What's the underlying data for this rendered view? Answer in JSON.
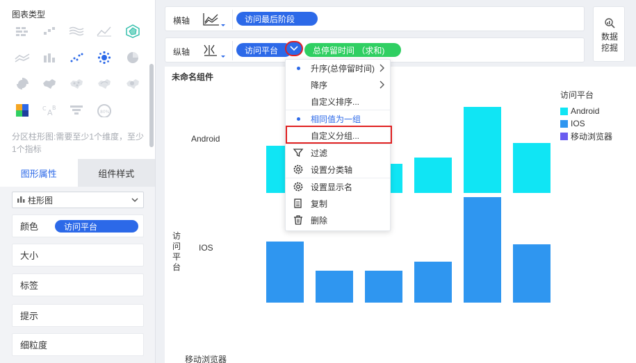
{
  "left_panel": {
    "title": "图表类型",
    "chart_types": [
      "stacked-bar-icon",
      "scatter-icon",
      "area-icon",
      "line-icon",
      "radar-icon",
      "stacked-line-icon",
      "column-icon",
      "dot-icon",
      "bubble-icon",
      "pie-icon",
      "rose-icon",
      "map-icon",
      "map-dot-icon",
      "map-flow-icon",
      "map-heat-icon",
      "heatmap-icon",
      "word-cloud-icon",
      "funnel-icon",
      "gauge-icon"
    ],
    "hint": "分区柱形图:需要至少1个维度，至少1个指标",
    "tabs": {
      "graph_props": "图形属性",
      "component_style": "组件样式"
    },
    "chart_select": "柱形图",
    "props": {
      "color_label": "颜色",
      "color_field": "访问平台",
      "size": "大小",
      "label": "标签",
      "tooltip": "提示",
      "granularity": "细粒度"
    }
  },
  "axes": {
    "x_label": "横轴",
    "x_field": "访问最后阶段",
    "y_label": "纵轴",
    "y_field": "访问平台",
    "y_metric": "总停留时间 （求和)"
  },
  "mining": {
    "line1": "数据",
    "line2": "挖掘"
  },
  "chart": {
    "component_name": "未命名组件",
    "y_axis_title": [
      "访",
      "问",
      "平",
      "台"
    ],
    "row_labels": [
      "Android",
      "IOS",
      "移动浏览器"
    ]
  },
  "chart_data": {
    "type": "bar",
    "facet_field": "访问平台",
    "facets": [
      "Android",
      "IOS",
      "移动浏览器"
    ],
    "series": [
      {
        "name": "Android",
        "color": "#10e5f4",
        "values": [
          0.55,
          0.44,
          0.34,
          0.41,
          1.0,
          0.58
        ]
      },
      {
        "name": "IOS",
        "color": "#2f96f0",
        "values": [
          0.58,
          0.3,
          0.3,
          0.39,
          1.0,
          0.55
        ]
      }
    ],
    "legend_title": "访问平台",
    "legend": [
      {
        "name": "Android",
        "color": "#10e5f4"
      },
      {
        "name": "IOS",
        "color": "#2f96f0"
      },
      {
        "name": "移动浏览器",
        "color": "#6a5cf0"
      }
    ]
  },
  "menu": {
    "asc": "升序(总停留时间)",
    "desc": "降序",
    "custom_sort": "自定义排序...",
    "same_group": "相同值为一组",
    "custom_group": "自定义分组...",
    "filter": "过滤",
    "set_axis": "设置分类轴",
    "set_name": "设置显示名",
    "copy": "复制",
    "delete": "删除"
  }
}
